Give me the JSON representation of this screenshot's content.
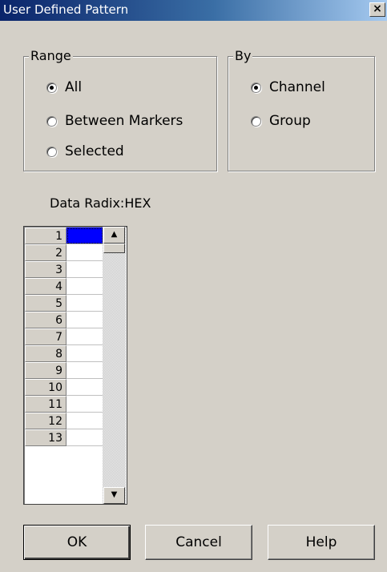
{
  "window": {
    "title": "User Defined Pattern",
    "close_label": "×"
  },
  "range_group": {
    "legend": "Range",
    "options": [
      {
        "label": "All",
        "checked": true
      },
      {
        "label": "Between Markers",
        "checked": false
      },
      {
        "label": "Selected",
        "checked": false
      }
    ]
  },
  "by_group": {
    "legend": "By",
    "options": [
      {
        "label": "Channel",
        "checked": true
      },
      {
        "label": "Group",
        "checked": false
      }
    ]
  },
  "data_radix": {
    "label": "Data  Radix:HEX"
  },
  "grid": {
    "rows": [
      "1",
      "2",
      "3",
      "4",
      "5",
      "6",
      "7",
      "8",
      "9",
      "10",
      "11",
      "12",
      "13"
    ],
    "values": [
      "",
      "",
      "",
      "",
      "",
      "",
      "",
      "",
      "",
      "",
      "",
      "",
      ""
    ],
    "selected_row": 0
  },
  "scrollbar": {
    "up_glyph": "▲",
    "down_glyph": "▼"
  },
  "buttons": {
    "ok": "OK",
    "cancel": "Cancel",
    "help": "Help"
  }
}
